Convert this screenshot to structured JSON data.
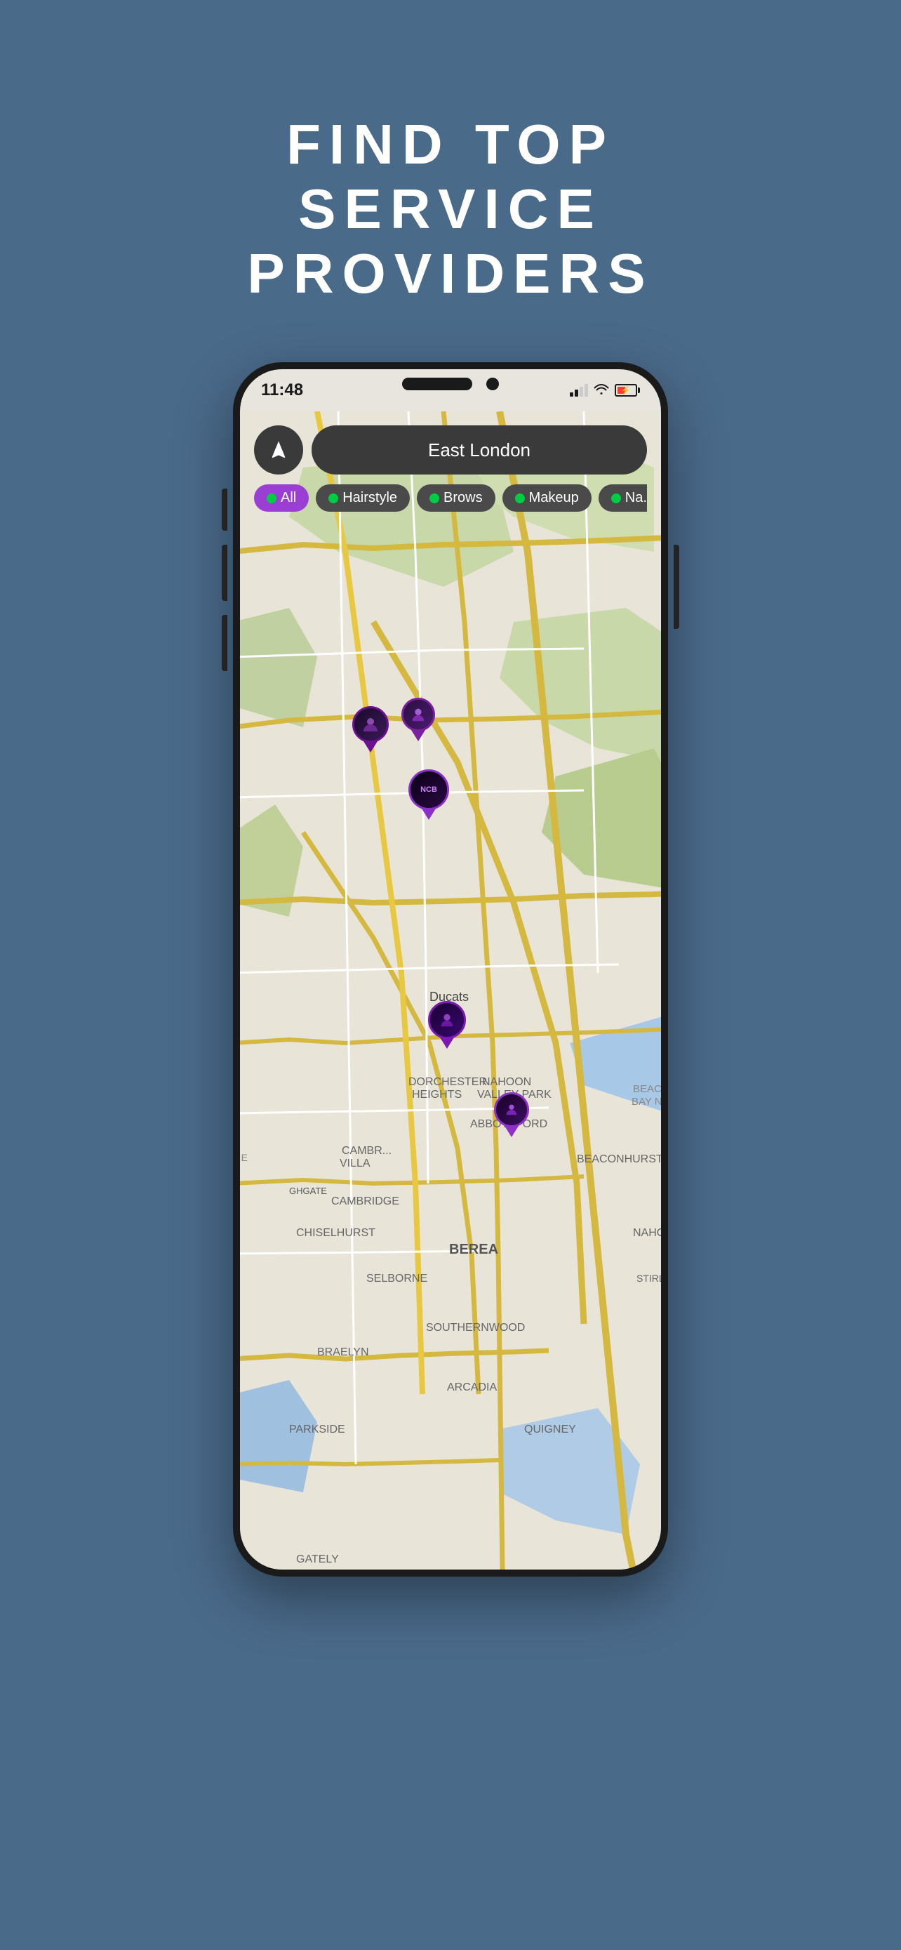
{
  "hero": {
    "line1": "FIND TOP",
    "line2": "SERVICE",
    "line3": "PROVIDERS"
  },
  "phone": {
    "status_bar": {
      "time": "11:48"
    },
    "search": {
      "location_label": "East London"
    },
    "filters": [
      {
        "id": "all",
        "label": "All",
        "active": true
      },
      {
        "id": "hairstyle",
        "label": "Hairstyle",
        "active": false
      },
      {
        "id": "brows",
        "label": "Brows",
        "active": false
      },
      {
        "id": "makeup",
        "label": "Makeup",
        "active": false
      },
      {
        "id": "nails",
        "label": "Na...",
        "active": false
      }
    ],
    "map": {
      "area_label": "East London",
      "districts": [
        "DORCHESTER HEIGHTS",
        "NAHOON VALLEY PARK",
        "ABBOTSFORD",
        "CAMBRIDGE VILLA",
        "BEACONHURST",
        "CAMBRIDGE",
        "BEREA",
        "CHISELHURST",
        "NAHOON",
        "SELBORNE",
        "STIRLI...",
        "SOUTHERNWOOD",
        "BRAELYN",
        "ARCADIA",
        "QUIGNEY",
        "PARKSIDE",
        "GATELY",
        "Ducats"
      ]
    }
  }
}
